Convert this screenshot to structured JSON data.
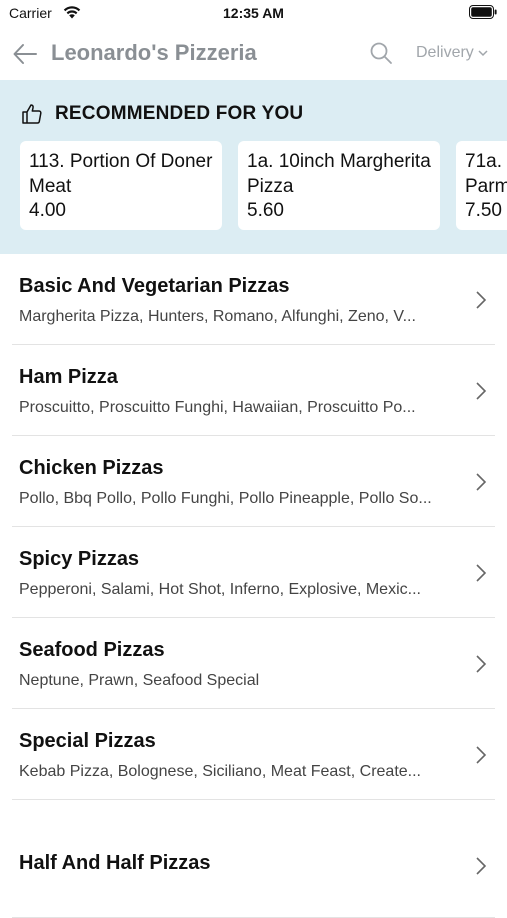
{
  "status_bar": {
    "carrier": "Carrier",
    "time": "12:35 AM"
  },
  "header": {
    "title": "Leonardo's Pizzeria",
    "delivery_label": "Delivery"
  },
  "recommended": {
    "title": "RECOMMENDED FOR YOU",
    "items": [
      {
        "name": "113. Portion Of Doner Meat",
        "price": "4.00"
      },
      {
        "name": "1a. 10inch Margherita Pizza",
        "price": "5.60"
      },
      {
        "name": "71a. Parm",
        "price": "7.50"
      }
    ]
  },
  "categories": [
    {
      "name": "Basic And Vegetarian Pizzas",
      "description": "Margherita Pizza, Hunters, Romano, Alfunghi, Zeno, V..."
    },
    {
      "name": "Ham Pizza",
      "description": "Proscuitto, Proscuitto Funghi, Hawaiian, Proscuitto Po..."
    },
    {
      "name": "Chicken Pizzas",
      "description": "Pollo, Bbq Pollo, Pollo Funghi, Pollo Pineapple, Pollo So..."
    },
    {
      "name": "Spicy Pizzas",
      "description": "Pepperoni, Salami, Hot Shot, Inferno, Explosive, Mexic..."
    },
    {
      "name": "Seafood Pizzas",
      "description": "Neptune, Prawn, Seafood Special"
    },
    {
      "name": "Special Pizzas",
      "description": "Kebab Pizza, Bolognese, Siciliano, Meat Feast, Create..."
    },
    {
      "name": "Half And Half Pizzas",
      "description": ""
    }
  ],
  "icons": {
    "back": "arrow-left-icon",
    "search": "search-icon",
    "dropdown": "chevron-down-icon",
    "recommended": "thumbs-up-icon",
    "row": "chevron-right-icon"
  },
  "colors": {
    "recommended_bg": "#dcedf3",
    "title_gray": "#8a8f94",
    "divider": "#e3e3e3"
  }
}
